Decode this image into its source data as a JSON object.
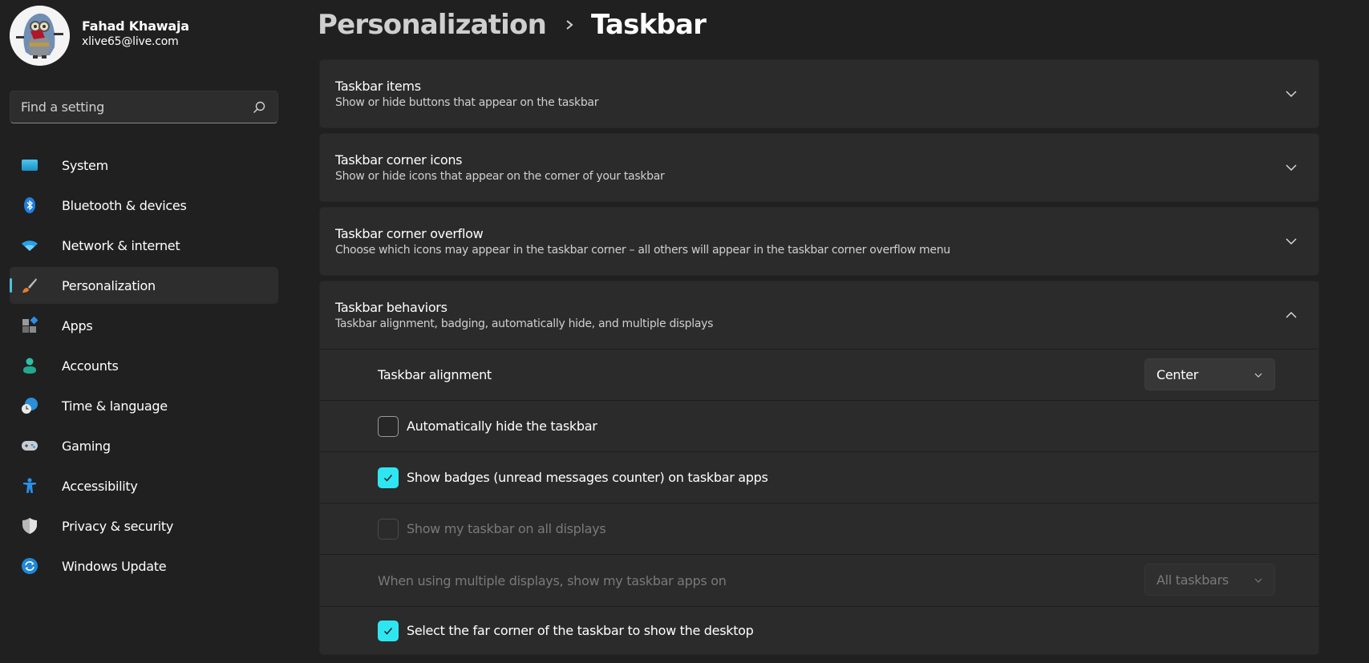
{
  "profile": {
    "name": "Fahad Khawaja",
    "email": "xlive65@live.com",
    "avatar_icon": "avatar-minion-image"
  },
  "search": {
    "placeholder": "Find a setting",
    "value": "",
    "icon": "search-icon"
  },
  "sidebar": {
    "active_index": 3,
    "accent_color": "#4cc2d7",
    "items": [
      {
        "label": "System",
        "icon": "monitor-icon"
      },
      {
        "label": "Bluetooth & devices",
        "icon": "bluetooth-icon"
      },
      {
        "label": "Network & internet",
        "icon": "wifi-icon"
      },
      {
        "label": "Personalization",
        "icon": "paintbrush-icon"
      },
      {
        "label": "Apps",
        "icon": "apps-icon"
      },
      {
        "label": "Accounts",
        "icon": "person-icon"
      },
      {
        "label": "Time & language",
        "icon": "globe-clock-icon"
      },
      {
        "label": "Gaming",
        "icon": "gamepad-icon"
      },
      {
        "label": "Accessibility",
        "icon": "accessibility-icon"
      },
      {
        "label": "Privacy & security",
        "icon": "shield-icon"
      },
      {
        "label": "Windows Update",
        "icon": "update-icon"
      }
    ]
  },
  "breadcrumb": {
    "parent": "Personalization",
    "separator_icon": "chevron-right-icon",
    "current": "Taskbar"
  },
  "cards": [
    {
      "title": "Taskbar items",
      "description": "Show or hide buttons that appear on the taskbar",
      "expanded": false
    },
    {
      "title": "Taskbar corner icons",
      "description": "Show or hide icons that appear on the corner of your taskbar",
      "expanded": false
    },
    {
      "title": "Taskbar corner overflow",
      "description": "Choose which icons may appear in the taskbar corner – all others will appear in the taskbar corner overflow menu",
      "expanded": false
    },
    {
      "title": "Taskbar behaviors",
      "description": "Taskbar alignment, badging, automatically hide, and multiple displays",
      "expanded": true
    }
  ],
  "behaviors": {
    "alignment": {
      "label": "Taskbar alignment",
      "value": "Center"
    },
    "auto_hide": {
      "label": "Automatically hide the taskbar",
      "checked": false,
      "enabled": true
    },
    "badges": {
      "label": "Show badges (unread messages counter) on taskbar apps",
      "checked": true,
      "enabled": true
    },
    "all_displays": {
      "label": "Show my taskbar on all displays",
      "checked": false,
      "enabled": false
    },
    "multi_display_apps": {
      "label": "When using multiple displays, show my taskbar apps on",
      "value": "All taskbars",
      "enabled": false
    },
    "far_corner": {
      "label": "Select the far corner of the taskbar to show the desktop",
      "checked": true,
      "enabled": true
    },
    "checkbox_accent": "#2ee6f2"
  }
}
